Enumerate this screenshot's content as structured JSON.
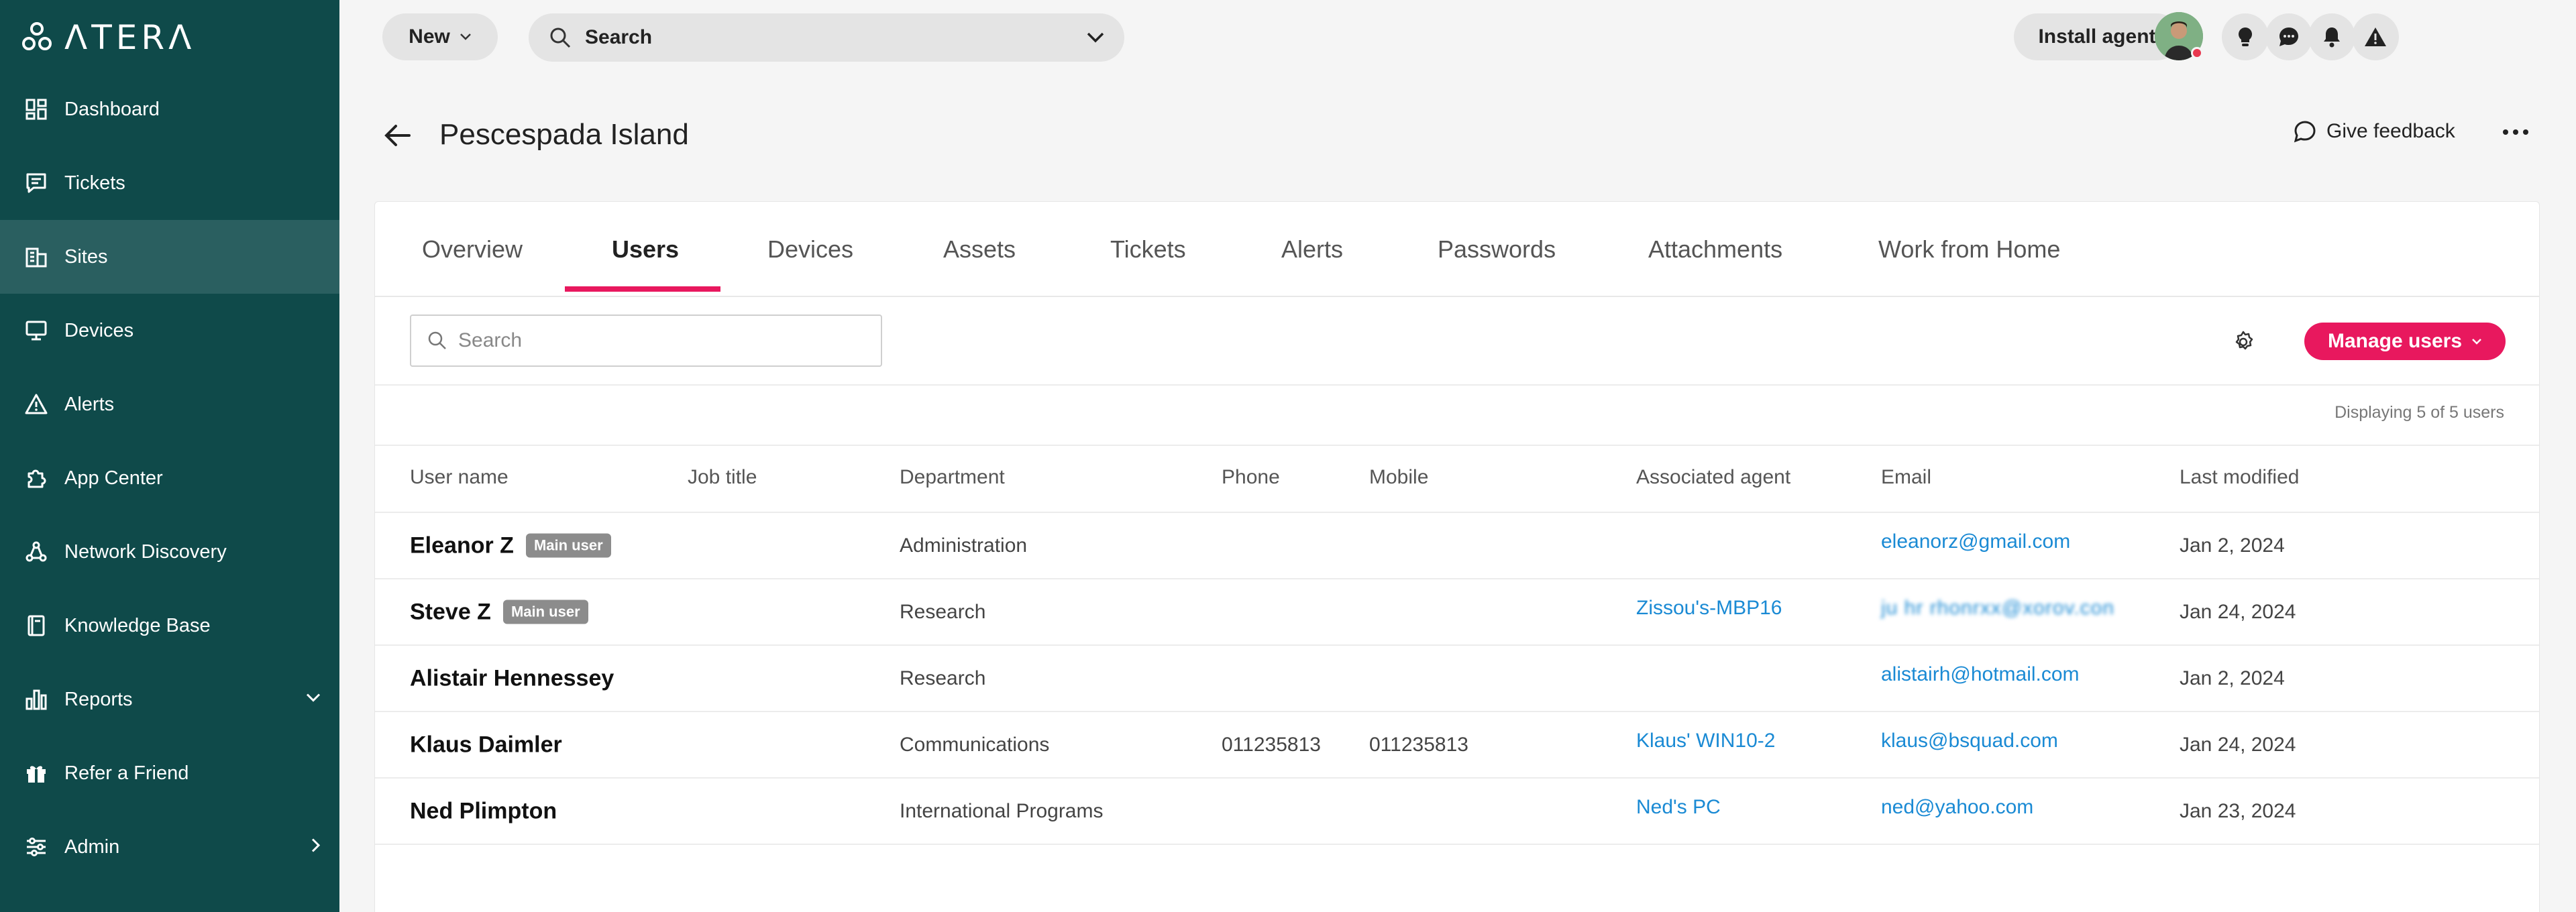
{
  "app": {
    "logo_text": "ΛTERΛ"
  },
  "sidebar": {
    "items": [
      {
        "label": "Dashboard",
        "icon": "dashboard-icon"
      },
      {
        "label": "Tickets",
        "icon": "ticket-icon"
      },
      {
        "label": "Sites",
        "icon": "building-icon",
        "active": true
      },
      {
        "label": "Devices",
        "icon": "monitor-icon"
      },
      {
        "label": "Alerts",
        "icon": "alert-triangle-icon"
      },
      {
        "label": "App Center",
        "icon": "puzzle-icon"
      },
      {
        "label": "Network Discovery",
        "icon": "network-icon"
      },
      {
        "label": "Knowledge Base",
        "icon": "book-icon"
      },
      {
        "label": "Reports",
        "icon": "bar-chart-icon",
        "caret": "chevron-down-icon"
      },
      {
        "label": "Refer a Friend",
        "icon": "gift-icon"
      },
      {
        "label": "Admin",
        "icon": "sliders-icon",
        "caret": "chevron-right-icon"
      }
    ]
  },
  "topbar": {
    "new_label": "New",
    "search_label": "Search",
    "install_label": "Install agent",
    "icons": [
      "lightbulb-icon",
      "chat-icon",
      "bell-icon",
      "warning-icon"
    ]
  },
  "header": {
    "title": "Pescespada Island",
    "feedback_label": "Give feedback"
  },
  "tabs": [
    {
      "label": "Overview"
    },
    {
      "label": "Users",
      "active": true
    },
    {
      "label": "Devices"
    },
    {
      "label": "Assets"
    },
    {
      "label": "Tickets"
    },
    {
      "label": "Alerts"
    },
    {
      "label": "Passwords"
    },
    {
      "label": "Attachments"
    },
    {
      "label": "Work from Home"
    }
  ],
  "users": {
    "search_placeholder": "Search",
    "manage_label": "Manage users",
    "display_count": "Displaying 5 of 5 users",
    "columns": [
      "User name",
      "Job title",
      "Department",
      "Phone",
      "Mobile",
      "Associated agent",
      "Email",
      "Last modified"
    ],
    "rows": [
      {
        "name": "Eleanor Z",
        "badge": "Main user",
        "job": "",
        "department": "Administration",
        "phone": "",
        "mobile": "",
        "agent": "",
        "email": "eleanorz@gmail.com",
        "modified": "Jan 2, 2024"
      },
      {
        "name": "Steve Z",
        "badge": "Main user",
        "job": "",
        "department": "Research",
        "phone": "",
        "mobile": "",
        "agent": "Zissou's-MBP16",
        "email": "ju hr  rhonrxx@xorov.con",
        "email_blurred": true,
        "modified": "Jan 24, 2024"
      },
      {
        "name": "Alistair Hennessey",
        "badge": "",
        "job": "",
        "department": "Research",
        "phone": "",
        "mobile": "",
        "agent": "",
        "email": "alistairh@hotmail.com",
        "modified": "Jan 2, 2024"
      },
      {
        "name": "Klaus Daimler",
        "badge": "",
        "job": "",
        "department": "Communications",
        "phone": "011235813",
        "mobile": "011235813",
        "agent": "Klaus' WIN10-2",
        "email": "klaus@bsquad.com",
        "modified": "Jan 24, 2024"
      },
      {
        "name": "Ned Plimpton",
        "badge": "",
        "job": "",
        "department": "International Programs",
        "phone": "",
        "mobile": "",
        "agent": "Ned's PC",
        "email": "ned@yahoo.com",
        "modified": "Jan 23, 2024"
      }
    ]
  },
  "colors": {
    "sidebar_bg": "#0f4a4a",
    "sidebar_active": "#2a5f60",
    "accent_pink": "#e8185e",
    "link_blue": "#1a8ad4"
  }
}
